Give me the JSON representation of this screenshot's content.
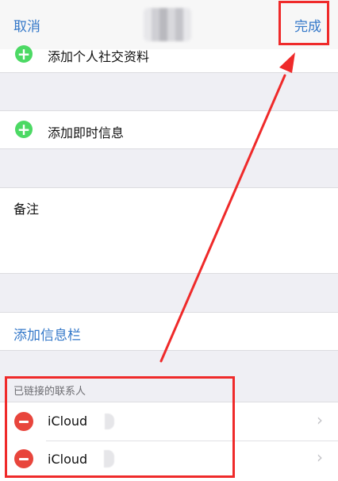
{
  "nav": {
    "cancel_label": "取消",
    "done_label": "完成"
  },
  "rows": {
    "social_profile_partial": "添加个人社交资料",
    "instant_message": "添加即时信息",
    "notes_label": "备注",
    "add_field": "添加信息栏"
  },
  "linked_contacts": {
    "header": "已链接的联系人",
    "items": [
      {
        "label": "iCloud"
      },
      {
        "label": "iCloud"
      }
    ]
  },
  "colors": {
    "accent_blue": "#3478c9",
    "highlight_red": "#ef2a2a",
    "add_green": "#4cd964",
    "remove_red": "#e8453c"
  }
}
